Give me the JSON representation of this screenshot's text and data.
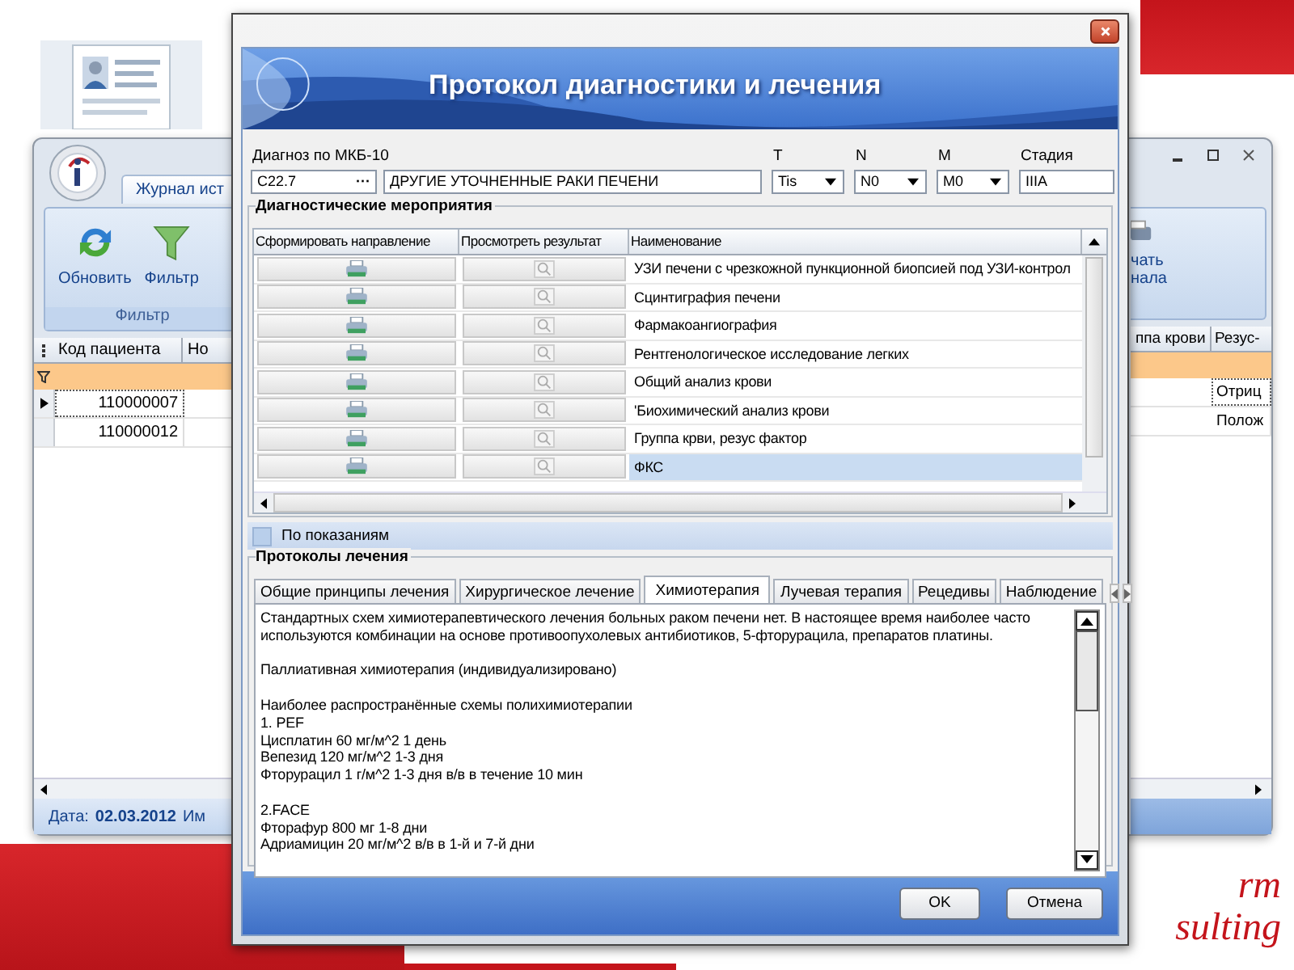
{
  "slide": {
    "thumbnail": {
      "kind": "picture"
    },
    "logo_lines": [
      "rm",
      "sulting"
    ]
  },
  "back_window": {
    "tab": "Журнал ист",
    "ribbon_buttons": [
      {
        "label": "Обновить",
        "kind": "refresh"
      },
      {
        "label": "Фильтр",
        "kind": "filter"
      }
    ],
    "ribbon_group": "Фильтр",
    "print_button_lines": [
      "чать",
      "нала"
    ],
    "columns_left": [
      "Код пациента",
      "Но"
    ],
    "columns_right": [
      "ппа крови",
      "Резус-"
    ],
    "rows": [
      {
        "code": "110000007",
        "rh": "Отриц",
        "selected": true
      },
      {
        "code": "110000012",
        "rh": "Полож",
        "selected": false
      }
    ],
    "status": {
      "label": "Дата:",
      "date": "02.03.2012",
      "next": "Им"
    }
  },
  "dialog": {
    "title": "Протокол диагностики и лечения",
    "diagnosis": {
      "label": "Диагноз по МКБ-10",
      "code": "C22.7",
      "button": "···",
      "name": "ДРУГИЕ УТОЧНЕННЫЕ РАКИ ПЕЧЕНИ"
    },
    "tnm": [
      {
        "label": "T",
        "value": "Tis"
      },
      {
        "label": "N",
        "value": "N0"
      },
      {
        "label": "M",
        "value": "M0"
      }
    ],
    "stage": {
      "label": "Стадия",
      "value": "IIIA"
    },
    "diagnostics": {
      "title": "Диагностические мероприятия",
      "columns": [
        "Сформировать направление",
        "Просмотреть результат",
        "Наименование"
      ],
      "rows": [
        {
          "name": "УЗИ печени с чрезкожной пункционной биопсией под УЗИ-контрол",
          "selected": false
        },
        {
          "name": "Сцинтиграфия печени",
          "selected": false
        },
        {
          "name": "Фармакоангиография",
          "selected": false
        },
        {
          "name": "Рентгенологическое исследование легких",
          "selected": false
        },
        {
          "name": "Общий анализ крови",
          "selected": false
        },
        {
          "name": "'Биохимический анализ крови",
          "selected": false
        },
        {
          "name": "Группа крви, резус фактор",
          "selected": false
        },
        {
          "name": "ФКС",
          "selected": true
        }
      ]
    },
    "indications": {
      "label": "По показаниям",
      "checked": false
    },
    "protocols": {
      "title": "Протоколы лечения",
      "tabs": [
        {
          "label": "Общие принципы лечения",
          "selected": false
        },
        {
          "label": "Хирургическое лечение",
          "selected": false
        },
        {
          "label": "Химиотерапия",
          "selected": true
        },
        {
          "label": "Лучевая терапия",
          "selected": false
        },
        {
          "label": "Рецедивы",
          "selected": false
        },
        {
          "label": "Наблюдение",
          "selected": false
        }
      ],
      "paragraphs": [
        [
          "Стандартных схем химиотерапевтического лечения больных раком печени нет. В настоящее время наиболее часто",
          "используются комбинации на основе противоопухолевых антибиотиков, 5-фторурацила, препаратов платины."
        ],
        [
          "Паллиативная химиотерапия (индивидуализировано)"
        ],
        [
          "Наиболее распространённые схемы полихимиотерапии",
          "1. PEF",
          "Цисплатин 60 мг/м^2 1 день",
          "Вепезид  120 мг/м^2 1-3 дня",
          "Фторурацил 1 г/м^2 1-3 дня в/в в течение 10 мин"
        ],
        [
          "2.FACE",
          "Фторафур 800 мг 1-8 дни",
          "Адриамицин 20 мг/м^2 в/в в 1-й и 7-й дни"
        ]
      ]
    },
    "buttons": [
      "OK",
      "Отмена"
    ]
  }
}
